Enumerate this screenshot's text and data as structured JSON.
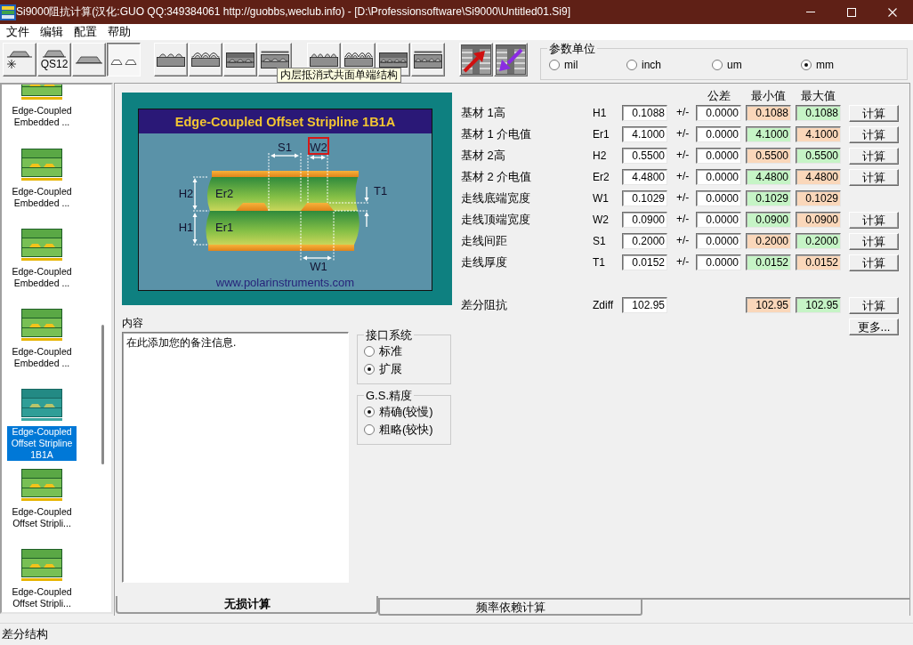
{
  "window": {
    "title": "Si9000阻抗计算(汉化:GUO QQ:349384061 http://guobbs,weclub.info) - [D:\\Professionsoftware\\Si9000\\Untitled01.Si9]"
  },
  "menu": [
    {
      "label": "文件"
    },
    {
      "label": "编辑"
    },
    {
      "label": "配置"
    },
    {
      "label": "帮助"
    }
  ],
  "toolbar": {
    "groups": [
      [
        {
          "kind": "mark",
          "selected": false
        },
        {
          "kind": "labelled",
          "label": "QS12",
          "selected": false
        },
        {
          "kind": "single",
          "selected": false
        },
        {
          "kind": "pair",
          "selected": true
        }
      ],
      [
        {
          "kind": "coplanar",
          "selected": false
        },
        {
          "kind": "coated",
          "selected": false
        },
        {
          "kind": "embedded",
          "selected": false
        },
        {
          "kind": "buried",
          "selected": false
        }
      ],
      [
        {
          "kind": "diffcoplanar",
          "selected": false
        },
        {
          "kind": "diffcoated",
          "selected": false
        },
        {
          "kind": "diffembedded",
          "selected": false
        },
        {
          "kind": "diffburied",
          "selected": false
        }
      ],
      [
        {
          "kind": "export",
          "selected": false
        },
        {
          "kind": "import",
          "selected": false
        }
      ]
    ],
    "tooltip": "内层抵消式共面单端结构"
  },
  "units": {
    "title": "参数单位",
    "options": [
      {
        "label": "mil",
        "selected": false
      },
      {
        "label": "inch",
        "selected": false
      },
      {
        "label": "um",
        "selected": false
      },
      {
        "label": "mm",
        "selected": true
      }
    ]
  },
  "sidebar": {
    "items": [
      {
        "label": "Edge-Coupled Embedded ...",
        "selected": false
      },
      {
        "label": "Edge-Coupled Embedded ...",
        "selected": false
      },
      {
        "label": "Edge-Coupled Embedded ...",
        "selected": false
      },
      {
        "label": "Edge-Coupled Embedded ...",
        "selected": false
      },
      {
        "label": "Edge-Coupled Offset Stripline 1B1A",
        "selected": true
      },
      {
        "label": "Edge-Coupled Offset Stripli...",
        "selected": false
      },
      {
        "label": "Edge-Coupled Offset Stripli...",
        "selected": false
      }
    ]
  },
  "diagram": {
    "title": "Edge-Coupled Offset Stripline 1B1A",
    "labels": {
      "spacing": {
        "text": "S1",
        "highlighted": false
      },
      "top_width": {
        "text": "W2",
        "highlighted": true
      },
      "upper_height": {
        "text": "H2",
        "highlighted": false
      },
      "upper_dielectric": {
        "text": "Er2",
        "highlighted": false
      },
      "lower_height": {
        "text": "H1",
        "highlighted": false
      },
      "lower_dielectric": {
        "text": "Er1",
        "highlighted": false
      },
      "thickness": {
        "text": "T1",
        "highlighted": false
      },
      "bottom_width": {
        "text": "W1",
        "highlighted": false
      }
    },
    "website": "www.polarinstruments.com"
  },
  "parameters": {
    "headers": {
      "tolerance": "公差",
      "min": "最小值",
      "max": "最大值"
    },
    "rows": [
      {
        "label": "基材 1高",
        "symbol": "H1",
        "value": "0.1088",
        "sign": "+/-",
        "tolerance": "0.0000",
        "min": {
          "value": "0.1088",
          "color": "#fad7ba"
        },
        "max": {
          "value": "0.1088",
          "color": "#c6f4c6"
        },
        "button": "计算"
      },
      {
        "label": "基材 1 介电值",
        "symbol": "Er1",
        "value": "4.1000",
        "sign": "+/-",
        "tolerance": "0.0000",
        "min": {
          "value": "4.1000",
          "color": "#c6f4c6"
        },
        "max": {
          "value": "4.1000",
          "color": "#fad7ba"
        },
        "button": "计算"
      },
      {
        "label": "基材 2高",
        "symbol": "H2",
        "value": "0.5500",
        "sign": "+/-",
        "tolerance": "0.0000",
        "min": {
          "value": "0.5500",
          "color": "#fad7ba"
        },
        "max": {
          "value": "0.5500",
          "color": "#c6f4c6"
        },
        "button": "计算"
      },
      {
        "label": "基材 2 介电值",
        "symbol": "Er2",
        "value": "4.4800",
        "sign": "+/-",
        "tolerance": "0.0000",
        "min": {
          "value": "4.4800",
          "color": "#c6f4c6"
        },
        "max": {
          "value": "4.4800",
          "color": "#fad7ba"
        },
        "button": "计算"
      },
      {
        "label": "走线底端宽度",
        "symbol": "W1",
        "value": "0.1029",
        "sign": "+/-",
        "tolerance": "0.0000",
        "min": {
          "value": "0.1029",
          "color": "#c6f4c6"
        },
        "max": {
          "value": "0.1029",
          "color": "#fad7ba"
        }
      },
      {
        "label": "走线顶端宽度",
        "symbol": "W2",
        "value": "0.0900",
        "sign": "+/-",
        "tolerance": "0.0000",
        "min": {
          "value": "0.0900",
          "color": "#c6f4c6"
        },
        "max": {
          "value": "0.0900",
          "color": "#fad7ba"
        },
        "button": "计算"
      },
      {
        "label": "走线间距",
        "symbol": "S1",
        "value": "0.2000",
        "sign": "+/-",
        "tolerance": "0.0000",
        "min": {
          "value": "0.2000",
          "color": "#fad7ba"
        },
        "max": {
          "value": "0.2000",
          "color": "#c6f4c6"
        },
        "button": "计算"
      },
      {
        "label": "走线厚度",
        "symbol": "T1",
        "value": "0.0152",
        "sign": "+/-",
        "tolerance": "0.0000",
        "min": {
          "value": "0.0152",
          "color": "#c6f4c6"
        },
        "max": {
          "value": "0.0152",
          "color": "#fad7ba"
        },
        "button": "计算"
      }
    ],
    "result": {
      "label": "差分阻抗",
      "symbol": "Zdiff",
      "value": "102.95",
      "min": {
        "value": "102.95",
        "color": "#fad7ba"
      },
      "max": {
        "value": "102.95",
        "color": "#c6f4c6"
      },
      "button": "计算"
    },
    "more_button": "更多..."
  },
  "notes": {
    "label": "内容",
    "value": "在此添加您的备注信息."
  },
  "interface": {
    "title": "接口系统",
    "options": [
      {
        "label": "标准",
        "selected": false
      },
      {
        "label": "扩展",
        "selected": true
      }
    ]
  },
  "precision": {
    "title": "G.S.精度",
    "options": [
      {
        "label": "精确(较慢)",
        "selected": true
      },
      {
        "label": "粗略(较快)",
        "selected": false
      }
    ]
  },
  "tabs": [
    {
      "label": "无损计算",
      "selected": true
    },
    {
      "label": "频率依赖计算",
      "selected": false
    }
  ],
  "status_bar": {
    "text": "差分结构"
  }
}
